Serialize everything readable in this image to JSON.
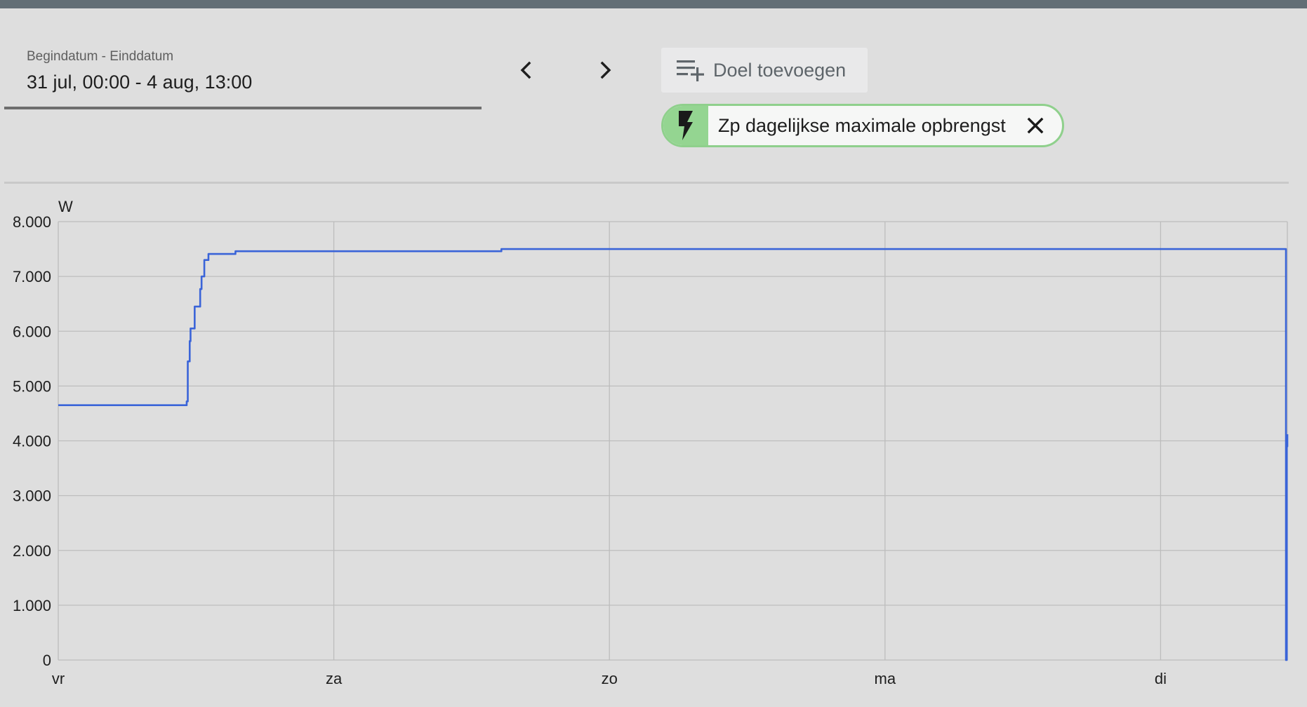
{
  "date_range": {
    "label": "Begindatum - Einddatum",
    "value": "31 jul, 00:00 - 4 aug, 13:00"
  },
  "nav": {
    "prev_icon": "chevron-left-icon",
    "next_icon": "chevron-right-icon"
  },
  "add_target": {
    "icon": "playlist-add-icon",
    "label": "Doel toevoegen"
  },
  "target_chip": {
    "icon": "lightning-bolt-icon",
    "label": "Zp dagelijkse maximale opbrengst",
    "close_icon": "close-icon",
    "color": "#94d591"
  },
  "chart_data": {
    "type": "line",
    "ylabel": "W",
    "ylim": [
      0,
      8000
    ],
    "yticks": [
      "0",
      "1.000",
      "2.000",
      "3.000",
      "4.000",
      "5.000",
      "6.000",
      "7.000",
      "8.000"
    ],
    "xlim_days": [
      0,
      4.46
    ],
    "xticks": [
      {
        "day": 0,
        "label": "vr"
      },
      {
        "day": 1,
        "label": "za"
      },
      {
        "day": 2,
        "label": "zo"
      },
      {
        "day": 3,
        "label": "ma"
      },
      {
        "day": 4,
        "label": "di"
      }
    ],
    "grid": true,
    "series": [
      {
        "color": "#3a64d8",
        "points": [
          [
            0.0,
            4650
          ],
          [
            0.46,
            4650
          ],
          [
            0.466,
            4720
          ],
          [
            0.47,
            5450
          ],
          [
            0.477,
            5820
          ],
          [
            0.48,
            6050
          ],
          [
            0.49,
            6050
          ],
          [
            0.495,
            6450
          ],
          [
            0.51,
            6450
          ],
          [
            0.515,
            6770
          ],
          [
            0.52,
            7000
          ],
          [
            0.53,
            7300
          ],
          [
            0.545,
            7410
          ],
          [
            0.64,
            7410
          ],
          [
            0.643,
            7460
          ],
          [
            1.6,
            7460
          ],
          [
            1.608,
            7500
          ],
          [
            4.45,
            7500
          ],
          [
            4.455,
            0
          ],
          [
            4.458,
            3900
          ],
          [
            4.46,
            4120
          ]
        ]
      }
    ]
  }
}
